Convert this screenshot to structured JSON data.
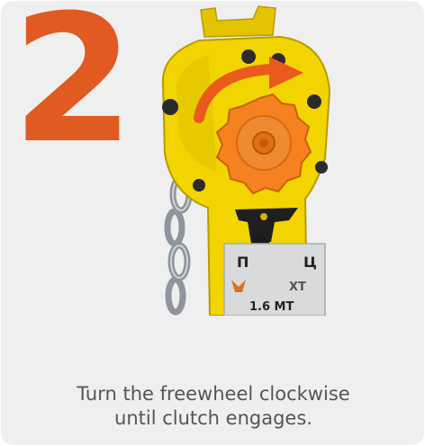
{
  "step": {
    "number": "2"
  },
  "photo": {
    "subject": "lever-hoist",
    "plate_labels": {
      "brand_left": "П",
      "brand_right": "Ц",
      "model": "XT",
      "capacity": "1.6 MT"
    },
    "colors": {
      "hoist_body": "#f2d400",
      "freewheel_knob": "#f5821f",
      "arrow": "#e95a1c",
      "chain": "#9aa0a6"
    }
  },
  "caption": {
    "line1": "Turn the freewheel clockwise",
    "line2": "until clutch engages."
  }
}
